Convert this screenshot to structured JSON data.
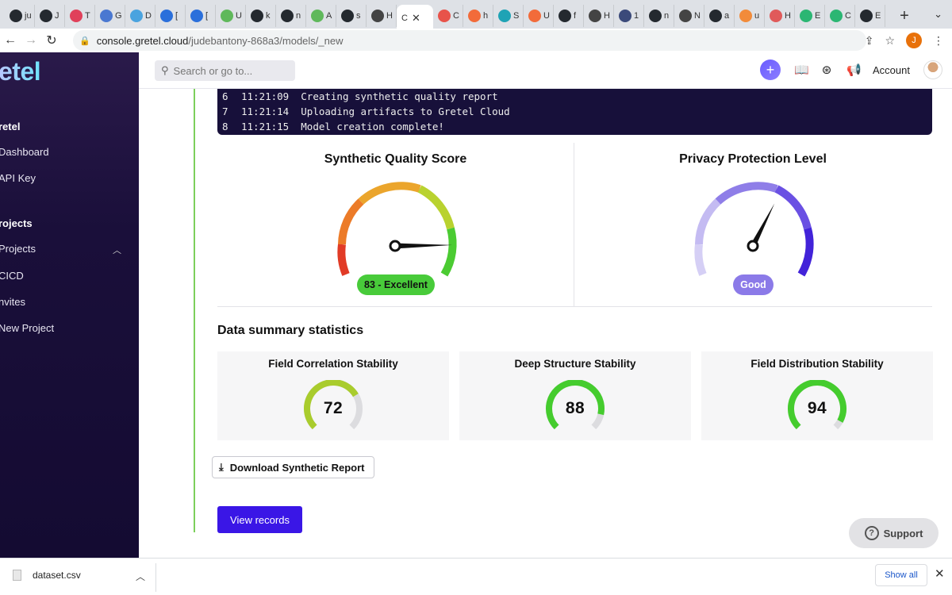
{
  "browser": {
    "tabs": [
      {
        "label": "ju",
        "color": "#24292f"
      },
      {
        "label": "J",
        "color": "#24292f"
      },
      {
        "label": "T",
        "color": "#e0405a"
      },
      {
        "label": "G",
        "color": "#4a78d1"
      },
      {
        "label": "D",
        "color": "#4aa3df"
      },
      {
        "label": "[",
        "color": "#2a6fdb"
      },
      {
        "label": "[",
        "color": "#2a6fdb"
      },
      {
        "label": "U",
        "color": "#5fb85b"
      },
      {
        "label": "k",
        "color": "#24292f"
      },
      {
        "label": "n",
        "color": "#24292f"
      },
      {
        "label": "A",
        "color": "#5fb85b"
      },
      {
        "label": "s",
        "color": "#24292f"
      },
      {
        "label": "H",
        "color": "#444444"
      }
    ],
    "active_tab": {
      "label": "C",
      "close": "✕"
    },
    "tabs_after": [
      {
        "label": "C",
        "color": "#e8534a"
      },
      {
        "label": "h",
        "color": "#f26b3a"
      },
      {
        "label": "S",
        "color": "#1fa3b5"
      },
      {
        "label": "U",
        "color": "#f26b3a"
      },
      {
        "label": "f",
        "color": "#24292f"
      },
      {
        "label": "H",
        "color": "#444444"
      },
      {
        "label": "1",
        "color": "#3b4a7a"
      },
      {
        "label": "n",
        "color": "#24292f"
      },
      {
        "label": "N",
        "color": "#444444"
      },
      {
        "label": "a",
        "color": "#24292f"
      },
      {
        "label": "u",
        "color": "#f28b3a"
      },
      {
        "label": "H",
        "color": "#e05a5a"
      },
      {
        "label": "E",
        "color": "#2bb673"
      },
      {
        "label": "C",
        "color": "#2bb673"
      },
      {
        "label": "E",
        "color": "#24292f"
      }
    ],
    "new_tab": "+",
    "url_host": "console.gretel.cloud",
    "url_path": "/judebantony-868a3/models/_new",
    "profile_initial": "J"
  },
  "sidebar": {
    "brand": "etel",
    "section1_title": "retel",
    "items1": [
      "Dashboard",
      "API Key"
    ],
    "section2_title": "rojects",
    "items2": [
      "Projects",
      "CICD",
      "nvites",
      "New Project"
    ]
  },
  "header": {
    "search_placeholder": "Search or go to...",
    "account": "Account"
  },
  "log": [
    {
      "n": "6",
      "time": "11:21:09",
      "msg": "Creating synthetic quality report"
    },
    {
      "n": "7",
      "time": "11:21:14",
      "msg": "Uploading artifacts to Gretel Cloud"
    },
    {
      "n": "8",
      "time": "11:21:15",
      "msg": "Model creation complete!"
    }
  ],
  "quality": {
    "title": "Synthetic Quality Score",
    "score": 83,
    "label": "83 - Excellent"
  },
  "privacy": {
    "title": "Privacy Protection Level",
    "label": "Good",
    "level_fraction": 0.6
  },
  "summary": {
    "title": "Data summary statistics",
    "cards": [
      {
        "title": "Field Correlation Stability",
        "value": "72",
        "fraction": 0.72,
        "color": "#a9cc2d"
      },
      {
        "title": "Deep Structure Stability",
        "value": "88",
        "fraction": 0.88,
        "color": "#45cc2e"
      },
      {
        "title": "Field Distribution Stability",
        "value": "94",
        "fraction": 0.94,
        "color": "#45cc2e"
      }
    ]
  },
  "actions": {
    "download_report": "Download Synthetic Report",
    "view_records": "View records",
    "support": "Support"
  },
  "downloads": {
    "file": "dataset.csv",
    "show_all": "Show all"
  }
}
